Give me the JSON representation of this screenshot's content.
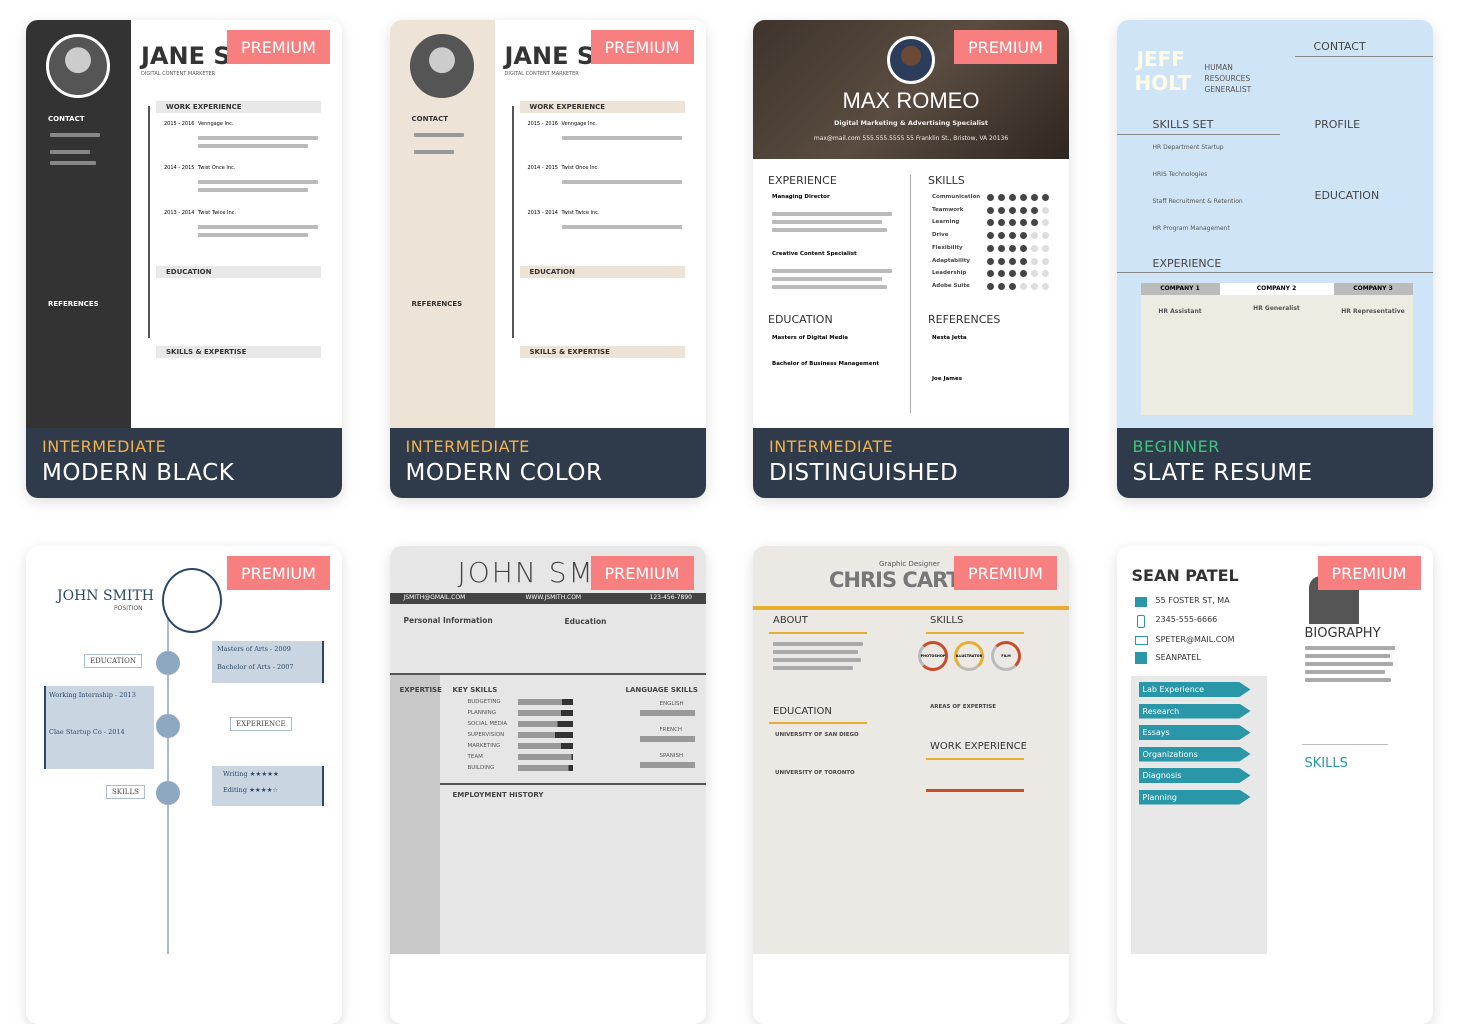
{
  "badge_label": "PREMIUM",
  "colors": {
    "footer": "#2f3b4a",
    "intermediate": "#f0b24a",
    "beginner": "#3dc47e",
    "premium": "#f77f7f"
  },
  "templates": [
    {
      "level": "INTERMEDIATE",
      "name": "MODERN BLACK",
      "premium": true,
      "preview": {
        "name": "JANE S",
        "title": "DIGITAL CONTENT MARKETER",
        "contact": "CONTACT",
        "references": "REFERENCES",
        "work": "WORK EXPERIENCE",
        "education": "EDUCATION",
        "skills": "SKILLS & EXPERTISE",
        "jobs": [
          "Venngage Inc.",
          "Twist Once Inc.",
          "Twist Twice Inc."
        ],
        "years": [
          "2015 - 2016",
          "2014 - 2015",
          "2013 - 2014"
        ]
      }
    },
    {
      "level": "INTERMEDIATE",
      "name": "MODERN COLOR",
      "premium": true,
      "preview": {
        "name": "JANE S",
        "title": "DIGITAL CONTENT MARKETER",
        "contact": "CONTACT",
        "references": "REFERENCES",
        "work": "WORK EXPERIENCE",
        "education": "EDUCATION",
        "skills": "SKILLS & EXPERTISE",
        "jobs": [
          "Venngage Inc.",
          "Twist Once Inc.",
          "Twist Twice Inc."
        ],
        "years": [
          "2015 - 2016",
          "2014 - 2015",
          "2013 - 2014"
        ]
      }
    },
    {
      "level": "INTERMEDIATE",
      "name": "DISTINGUISHED",
      "premium": true,
      "preview": {
        "name": "MAX ROMEO",
        "title": "Digital Marketing & Advertising Specialist",
        "contact": "max@mail.com   555.555.5555   55 Franklin St., Bristow, VA 20136",
        "experience": "EXPERIENCE",
        "skills": "SKILLS",
        "education": "EDUCATION",
        "references": "REFERENCES",
        "jobs": [
          "Managing Director",
          "Creative Content Specialist"
        ],
        "degrees": [
          "Masters of Digital Media",
          "Bachelor of Business Management"
        ],
        "skill_list": [
          {
            "name": "Communication",
            "level": 6
          },
          {
            "name": "Teamwork",
            "level": 5
          },
          {
            "name": "Learning",
            "level": 5
          },
          {
            "name": "Drive",
            "level": 4
          },
          {
            "name": "Flexibility",
            "level": 4
          },
          {
            "name": "Adaptability",
            "level": 4
          },
          {
            "name": "Leadership",
            "level": 4
          },
          {
            "name": "Adobe Suite",
            "level": 3
          }
        ],
        "refs": [
          "Nesta Jetta",
          "Joe James"
        ]
      }
    },
    {
      "level": "BEGINNER",
      "name": "SLATE RESUME",
      "premium": false,
      "preview": {
        "name1": "JEFF",
        "name2": "HOLT",
        "title": "HUMAN RESOURCES GENERALIST",
        "contact": "CONTACT",
        "skills": "SKILLS SET",
        "profile": "PROFILE",
        "education": "EDUCATION",
        "experience": "EXPERIENCE",
        "skill_list": [
          "HR Department Startup",
          "HRIS Technologies",
          "Staff Recruitment & Retention",
          "HR Program Management"
        ],
        "companies": [
          "COMPANY 1",
          "COMPANY 2",
          "COMPANY 3"
        ],
        "roles": [
          "HR Assistant",
          "HR Generalist",
          "HR Representative"
        ]
      }
    },
    {
      "level": "",
      "name": "",
      "premium": true,
      "preview": {
        "name": "JOHN SMITH",
        "title": "POSITION",
        "education": "EDUCATION",
        "experience": "EXPERIENCE",
        "skills": "SKILLS",
        "items": [
          "Masters of Arts - 2009",
          "Bachelor of Arts - 2007",
          "Working Internship - 2013",
          "Clae Startup Co - 2014",
          "Writing ★★★★★",
          "Editing ★★★★☆"
        ]
      }
    },
    {
      "level": "",
      "name": "",
      "premium": true,
      "preview": {
        "name": "JOHN SM",
        "email": "JSMITH@GMAIL.COM",
        "web": "WWW.JSMITH.COM",
        "phone": "123-456-7890",
        "personal": "Personal Information",
        "education": "Education",
        "expertise": "EXPERTISE",
        "key_skills": "KEY SKILLS",
        "language": "LANGUAGE SKILLS",
        "employment": "EMPLOYMENT HISTORY",
        "skill_list": [
          "BUDGETING",
          "PLANNING",
          "SOCIAL MEDIA",
          "SUPERVISION",
          "MARKETING",
          "TEAM",
          "BUILDING"
        ],
        "languages": [
          "ENGLISH",
          "FRENCH",
          "SPANISH"
        ]
      }
    },
    {
      "level": "",
      "name": "",
      "premium": true,
      "preview": {
        "name": "CHRIS CARTER",
        "title": "Graphic Designer",
        "about": "ABOUT",
        "skills": "SKILLS",
        "education": "EDUCATION",
        "work": "WORK EXPERIENCE",
        "circles": [
          "PHOTOSHOP",
          "ILLUSTRATOR",
          "FILM"
        ],
        "schools": [
          "UNIVERSITY OF SAN DIEGO",
          "UNIVERSITY OF TORONTO"
        ],
        "areas": "AREAS OF EXPERTISE"
      }
    },
    {
      "level": "",
      "name": "",
      "premium": true,
      "preview": {
        "name": "SEAN PATEL",
        "contacts": [
          "55 FOSTER ST, MA",
          "2345-555-6666",
          "SPETER@MAIL.COM",
          "SEANPATEL"
        ],
        "biography": "BIOGRAPHY",
        "skills": "SKILLS",
        "arrows": [
          "Lab Experience",
          "Research",
          "Essays",
          "Organizations",
          "Diagnosis",
          "Planning"
        ]
      }
    }
  ]
}
